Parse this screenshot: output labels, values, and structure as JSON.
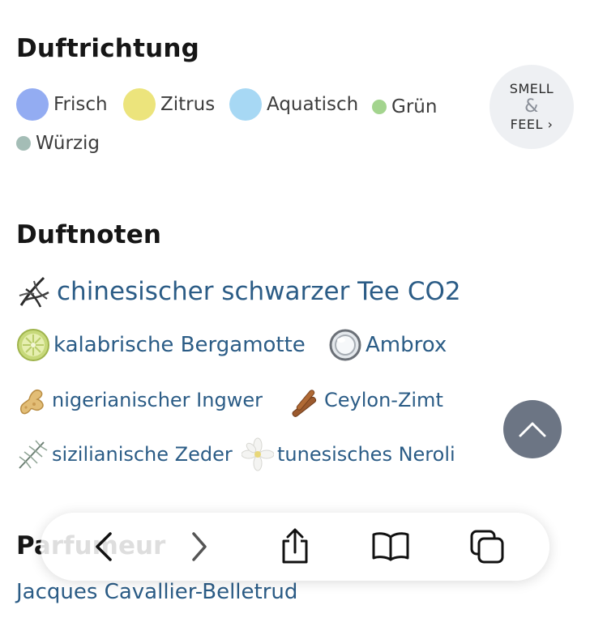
{
  "scent_direction": {
    "title": "Duftrichtung",
    "items": [
      {
        "label": "Frisch",
        "color": "#93acf2"
      },
      {
        "label": "Zitrus",
        "color": "#ece47c"
      },
      {
        "label": "Aquatisch",
        "color": "#a7d8f4"
      },
      {
        "label": "Grün",
        "color": "#a3d48e"
      },
      {
        "label": "Würzig",
        "color": "#a4bdb6"
      }
    ],
    "smell_feel": {
      "line1": "SMELL",
      "amp": "&",
      "line2": "FEEL ›"
    }
  },
  "notes": {
    "title": "Duftnoten",
    "items": [
      {
        "label": "chinesischer schwarzer Tee CO2",
        "icon": "black-tea-icon"
      },
      {
        "label": "kalabrische Bergamotte",
        "icon": "bergamot-icon"
      },
      {
        "label": "Ambrox",
        "icon": "ambrox-icon"
      },
      {
        "label": "nigerianischer Ingwer",
        "icon": "ginger-icon"
      },
      {
        "label": "Ceylon-Zimt",
        "icon": "cinnamon-icon"
      },
      {
        "label": "sizilianische Zeder",
        "icon": "cedar-icon"
      },
      {
        "label": "tunesisches Neroli",
        "icon": "neroli-flower-icon"
      }
    ]
  },
  "perfumer": {
    "title": "Parfumeur",
    "name": "Jacques Cavallier-Belletrud"
  },
  "accent_color": "#2b5c86",
  "toolbar": {
    "buttons": [
      "back-icon",
      "forward-icon",
      "share-icon",
      "bookmarks-icon",
      "tabs-icon"
    ]
  }
}
